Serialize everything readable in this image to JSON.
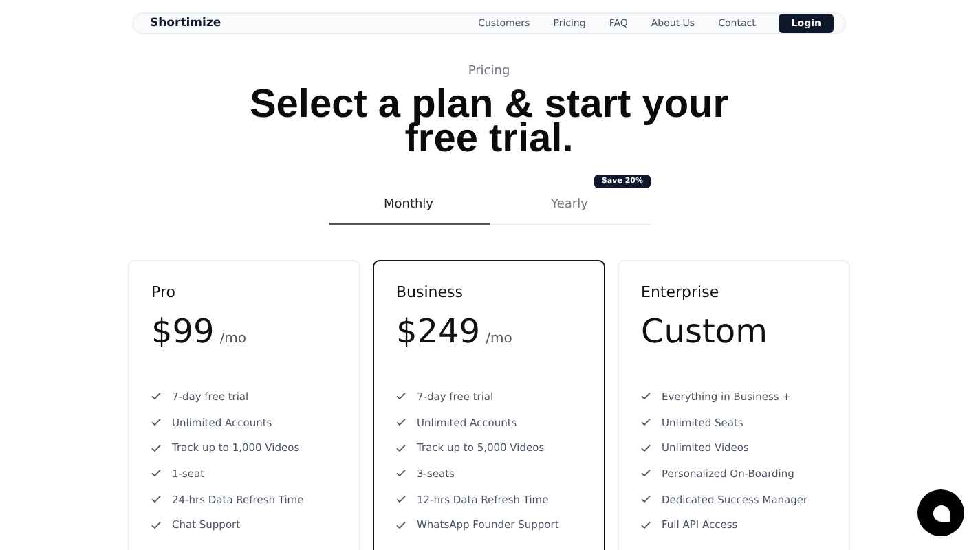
{
  "nav": {
    "brand": "Shortimize",
    "links": [
      "Customers",
      "Pricing",
      "FAQ",
      "About Us",
      "Contact"
    ],
    "login": "Login"
  },
  "eyebrow": "Pricing",
  "title": "Select a plan & start your free trial.",
  "billing_tabs": [
    {
      "label": "Monthly",
      "selected": true
    },
    {
      "label": "Yearly",
      "selected": false,
      "badge": "Save 20%"
    }
  ],
  "plans": [
    {
      "name": "Pro",
      "price": "$99",
      "period": "/mo",
      "selected": false,
      "features": [
        "7-day free trial",
        "Unlimited Accounts",
        "Track up to 1,000 Videos",
        "1-seat",
        "24-hrs Data Refresh Time",
        "Chat Support"
      ]
    },
    {
      "name": "Business",
      "price": "$249",
      "period": "/mo",
      "selected": true,
      "features": [
        "7-day free trial",
        "Unlimited Accounts",
        "Track up to 5,000 Videos",
        "3-seats",
        "12-hrs Data Refresh Time",
        "WhatsApp Founder Support"
      ]
    },
    {
      "name": "Enterprise",
      "price": "Custom",
      "selected": false,
      "features": [
        "Everything in Business +",
        "Unlimited Seats",
        "Unlimited Videos",
        "Personalized On-Boarding",
        "Dedicated Success Manager",
        "Full API Access"
      ]
    }
  ]
}
